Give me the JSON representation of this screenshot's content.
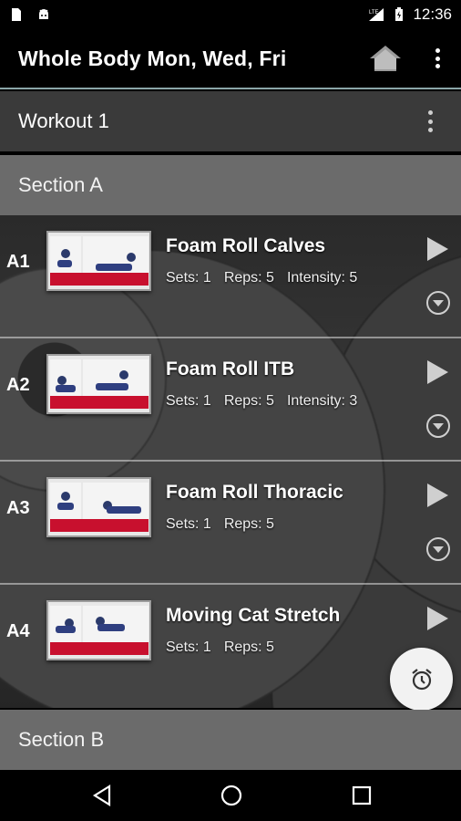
{
  "status_bar": {
    "time": "12:36",
    "left_icons": [
      "file-icon",
      "android-icon"
    ],
    "right_icons": [
      "signal-icon",
      "battery-icon"
    ],
    "signal_label": "LTE"
  },
  "app_bar": {
    "title": "Whole Body Mon, Wed, Fri",
    "home_icon": "home-icon",
    "overflow_icon": "overflow-menu-icon"
  },
  "workout": {
    "title": "Workout 1"
  },
  "sections": [
    {
      "title": "Section A",
      "items": [
        {
          "code": "A1",
          "name": "Foam Roll Calves",
          "sets": "Sets: 1",
          "reps": "Reps: 5",
          "intensity": "Intensity: 5"
        },
        {
          "code": "A2",
          "name": "Foam Roll ITB",
          "sets": "Sets: 1",
          "reps": "Reps: 5",
          "intensity": "Intensity: 3"
        },
        {
          "code": "A3",
          "name": "Foam Roll Thoracic",
          "sets": "Sets: 1",
          "reps": "Reps: 5"
        },
        {
          "code": "A4",
          "name": "Moving Cat Stretch",
          "sets": "Sets: 1",
          "reps": "Reps: 5"
        }
      ]
    },
    {
      "title": "Section B"
    }
  ],
  "fab": {
    "icon": "alarm-clock-icon"
  },
  "nav_bar": {
    "icons": [
      "back-icon",
      "home-circle-icon",
      "recents-icon"
    ]
  },
  "colors": {
    "app_bar_bg": "#000000",
    "workout_bar_bg": "#3a3a3a",
    "section_bg": "#6b6b6b",
    "mat_red": "#c8102e",
    "fab_bg": "#f2f2f2"
  }
}
